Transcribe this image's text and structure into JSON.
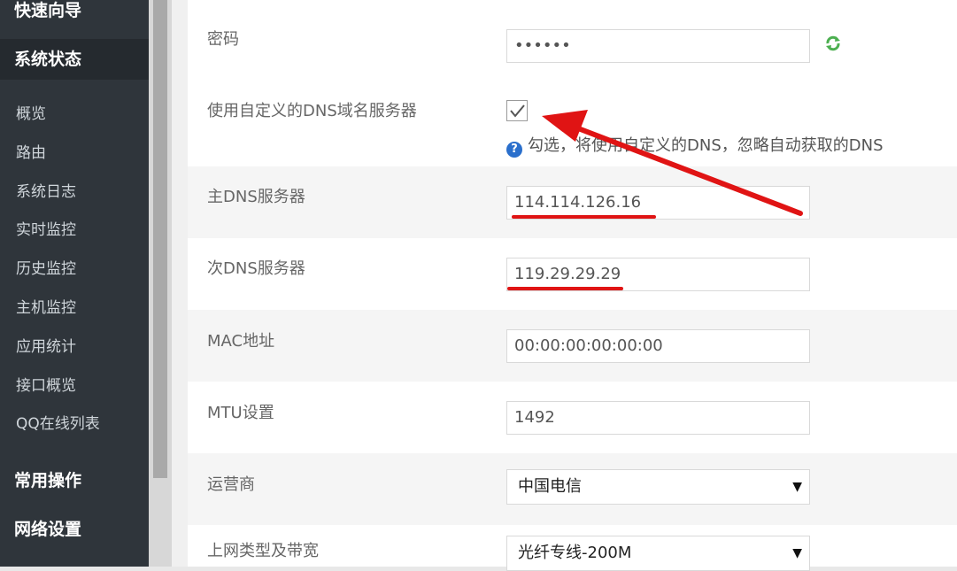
{
  "sidebar": {
    "groups": {
      "quick_guide": "快速向导",
      "system_status": "系统状态",
      "common_ops": "常用操作",
      "network_settings": "网络设置"
    },
    "items": [
      "概览",
      "路由",
      "系统日志",
      "实时监控",
      "历史监控",
      "主机监控",
      "应用统计",
      "接口概览",
      "QQ在线列表"
    ]
  },
  "form": {
    "password": {
      "label": "密码",
      "value": "••••••"
    },
    "custom_dns": {
      "label": "使用自定义的DNS域名服务器",
      "checked": true,
      "help": "勾选，将使用自定义的DNS，忽略自动获取的DNS"
    },
    "primary_dns": {
      "label": "主DNS服务器",
      "value": "114.114.126.16"
    },
    "secondary_dns": {
      "label": "次DNS服务器",
      "value": "119.29.29.29"
    },
    "mac": {
      "label": "MAC地址",
      "value": "00:00:00:00:00:00"
    },
    "mtu": {
      "label": "MTU设置",
      "value": "1492"
    },
    "isp": {
      "label": "运营商",
      "value": "中国电信"
    },
    "net_type": {
      "label": "上网类型及带宽",
      "value": "光纤专线-200M"
    }
  },
  "colors": {
    "sidebar_bg": "#2f353b",
    "accent_red": "#e01414",
    "help_blue": "#2a6fcc",
    "refresh_green": "#4caf50"
  }
}
